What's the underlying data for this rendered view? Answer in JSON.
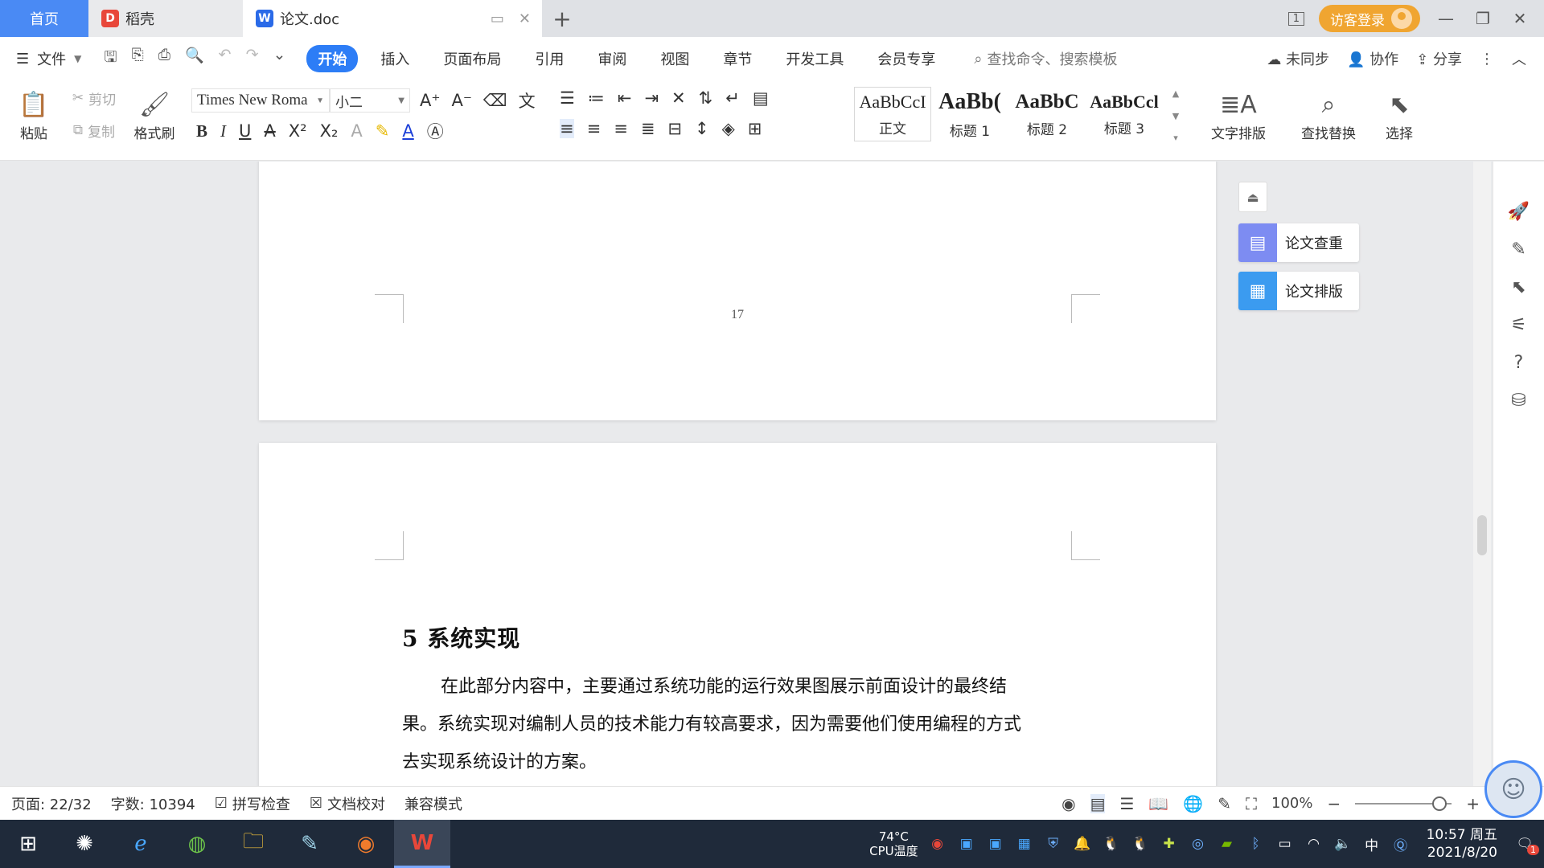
{
  "tabs": {
    "home": "首页",
    "docer": "稻壳",
    "document": "论文.doc",
    "add_icon": "plus-icon"
  },
  "titlebar": {
    "login": "访客登录",
    "page_badge": "1"
  },
  "menu": {
    "file": "文件",
    "tabs": [
      "开始",
      "插入",
      "页面布局",
      "引用",
      "审阅",
      "视图",
      "章节",
      "开发工具",
      "会员专享"
    ],
    "search": "查找命令、搜索模板",
    "sync": "未同步",
    "collab": "协作",
    "share": "分享"
  },
  "ribbon": {
    "paste": "粘贴",
    "cut": "剪切",
    "copy": "复制",
    "format_painter": "格式刷",
    "font_name": "Times New Roma",
    "font_size": "小二",
    "styles": [
      {
        "sample": "AaBbCcI",
        "name": "正文"
      },
      {
        "sample": "AaBb(",
        "name": "标题 1"
      },
      {
        "sample": "AaBbC",
        "name": "标题 2"
      },
      {
        "sample": "AaBbCcl",
        "name": "标题 3"
      }
    ],
    "text_layout": "文字排版",
    "find_replace": "查找替换",
    "select": "选择"
  },
  "document": {
    "page_number": "17",
    "heading": "5  系统实现",
    "paragraph_lines": [
      "在此部分内容中，主要通过系统功能的运行效果图展示前面设计的最终结",
      "果。系统实现对编制人员的技术能力有较高要求，因为需要他们使用编程的方式",
      "去实现系统设计的方案。"
    ]
  },
  "side_panel": {
    "paper_check": "论文查重",
    "paper_format": "论文排版"
  },
  "status": {
    "page": "页面: 22/32",
    "words": "字数: 10394",
    "spell": "拼写检查",
    "proof": "文档校对",
    "compat": "兼容模式",
    "zoom": "100%"
  },
  "taskbar": {
    "cpu_temp": "74°C",
    "cpu_label": "CPU温度",
    "ime": "中",
    "time": "10:57 周五",
    "date": "2021/8/20",
    "notify_count": "1"
  }
}
